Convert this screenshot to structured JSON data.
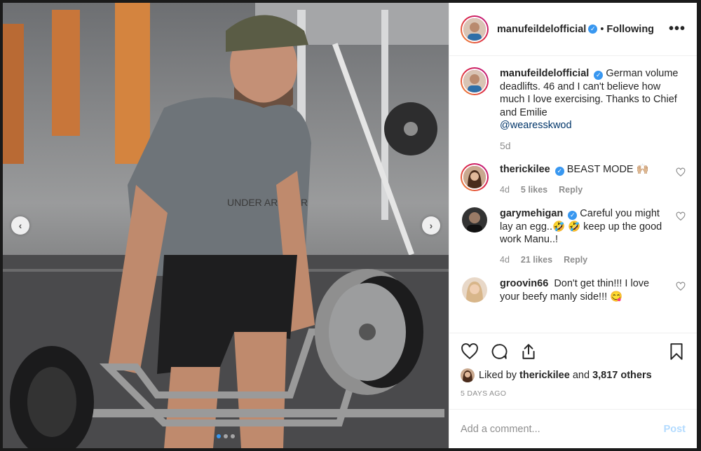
{
  "header": {
    "username": "manufeildelofficial",
    "separator": "•",
    "follow_state": "Following",
    "more_label": "•••"
  },
  "caption": {
    "username": "manufeildelofficial",
    "text": "German volume deadlifts. 46 and I can't believe how much I love exercising. Thanks to Chief and Emilie",
    "mention": "@wearesskwod",
    "time": "5d"
  },
  "comments": [
    {
      "username": "therickilee",
      "verified": true,
      "text": "BEAST MODE 🙌🏼",
      "time": "4d",
      "likes": "5 likes",
      "reply": "Reply"
    },
    {
      "username": "garymehigan",
      "verified": true,
      "text": "Careful you might lay an egg..🤣 🤣  keep up the good work Manu..!",
      "time": "4d",
      "likes": "21 likes",
      "reply": "Reply"
    },
    {
      "username": "groovin66",
      "verified": false,
      "text": "Don't get thin!!! I love your beefy manly side!!! 😋"
    }
  ],
  "likes": {
    "prefix": "Liked by",
    "user": "therickilee",
    "and": "and",
    "others": "3,817 others"
  },
  "post_date": "5 DAYS AGO",
  "add_comment": {
    "placeholder": "Add a comment...",
    "post_label": "Post"
  },
  "carousel": {
    "prev": "‹",
    "next": "›",
    "slides": 3,
    "active": 1
  },
  "colors": {
    "verified": "#3897f0",
    "link": "#003569",
    "post_disabled": "#b3dbff",
    "muted": "#8e8e8e"
  }
}
